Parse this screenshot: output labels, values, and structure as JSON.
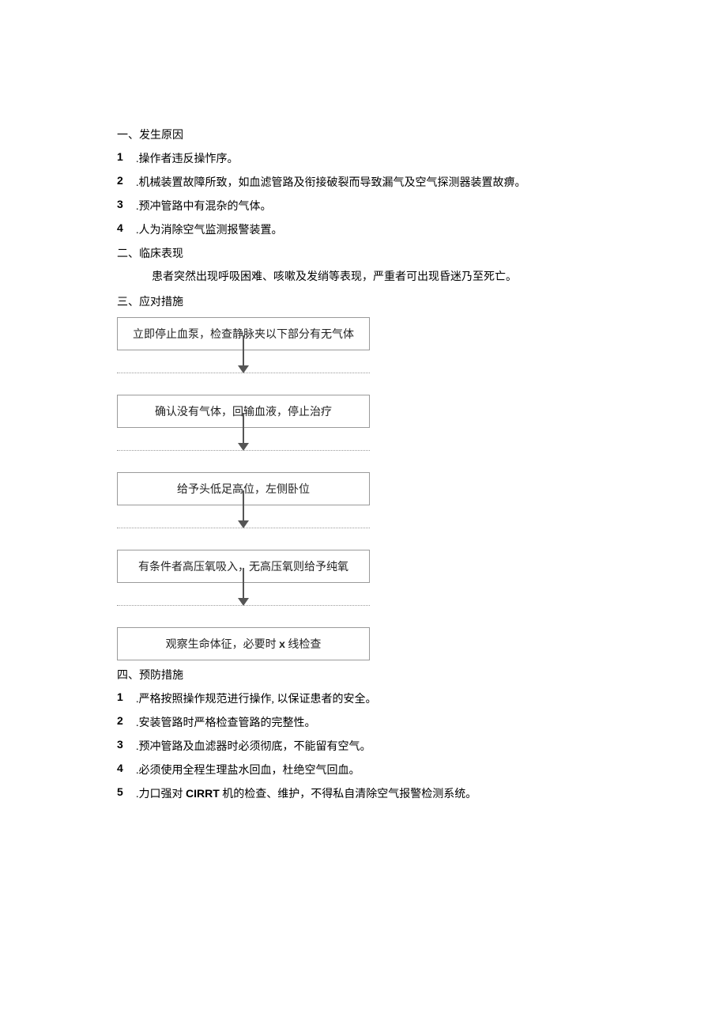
{
  "section1": {
    "heading": "一、发生原因",
    "items": [
      ".操作者违反操怍序。",
      ".机械装置故障所致，如血滤管路及衔接破裂而导致漏气及空气探测器装置故痹。",
      ".预冲管路中有混杂的气体。",
      ".人为消除空气监测报警装置。"
    ]
  },
  "section2": {
    "heading": "二、临床表现",
    "body": "患者突然出现呼吸困难、咳嗽及发绡等表现，严重者可出现昏迷乃至死亡。"
  },
  "section3": {
    "heading": "三、应对措施",
    "flow": [
      "立即停止血泵，检查静脉夹以下部分有无气体",
      "确认没有气体，回输血液，停止治疗",
      "给予头低足高位，左侧卧位",
      "有条件者高压氧吸入，无高压氧则给予纯氧"
    ],
    "flow_last_prefix": "观察生命体征，必要时 ",
    "flow_last_x": "x",
    "flow_last_suffix": " 线检查"
  },
  "section4": {
    "heading": "四、预防措施",
    "items": [
      ".严格按照操作规范进行操作, 以保证患者的安全。",
      ".安装管路时严格检查管路的完整性。",
      ".预冲管路及血滤器时必须彻底，不能留有空气。",
      ".必须使用全程生理盐水回血，杜绝空气回血。"
    ],
    "item5_prefix": ".力口强对 ",
    "item5_bold": "CIRRT",
    "item5_suffix": " 机的检查、维护，不得私自清除空气报警检测系统。"
  },
  "nums": [
    "1",
    "2",
    "3",
    "4",
    "5"
  ]
}
